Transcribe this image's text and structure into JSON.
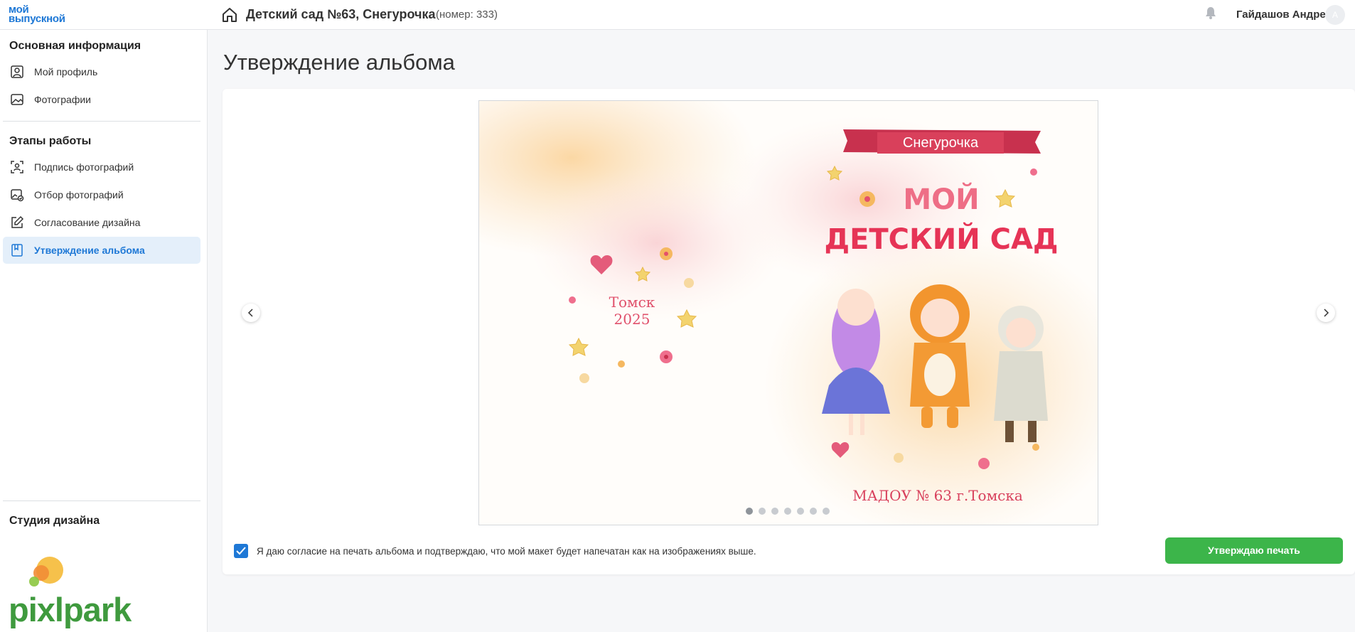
{
  "header": {
    "logo_line1": "мой",
    "logo_line2": "выпускной",
    "kindergarten_title": "Детский сад №63, Снегурочка",
    "kindergarten_number": "(номер: 333)",
    "user_name": "Гайдашов Андрей",
    "avatar_initial": "А"
  },
  "sidebar": {
    "section_basic": "Основная информация",
    "section_stages": "Этапы работы",
    "section_studio": "Студия дизайна",
    "items": [
      {
        "label": "Мой профиль",
        "icon": "profile-icon"
      },
      {
        "label": "Фотографии",
        "icon": "photos-icon"
      },
      {
        "label": "Подпись фотографий",
        "icon": "face-scan-icon"
      },
      {
        "label": "Отбор фотографий",
        "icon": "photo-select-icon"
      },
      {
        "label": "Согласование дизайна",
        "icon": "pencil-icon"
      },
      {
        "label": "Утверждение альбома",
        "icon": "album-icon",
        "active": true
      }
    ],
    "studio_logo_text": "pixlpark"
  },
  "main": {
    "page_title": "Утверждение альбома",
    "slide": {
      "ribbon_text": "Снегурочка",
      "headline_line1": "МОЙ",
      "headline_line2": "ДЕТСКИЙ САД",
      "city": "Томск",
      "year": "2025",
      "footer": "МАДОУ № 63 г.Томска"
    },
    "slides_total": 7,
    "current_slide": 1,
    "consent_checked": true,
    "consent_text": "Я даю согласие на печать альбома и подтверждаю, что мой макет будет напечатан как на изображениях выше.",
    "approve_button": "Утверждаю печать"
  },
  "colors": {
    "accent": "#1e78d6",
    "approve": "#3cb54a",
    "active_bg": "#e4effa"
  }
}
